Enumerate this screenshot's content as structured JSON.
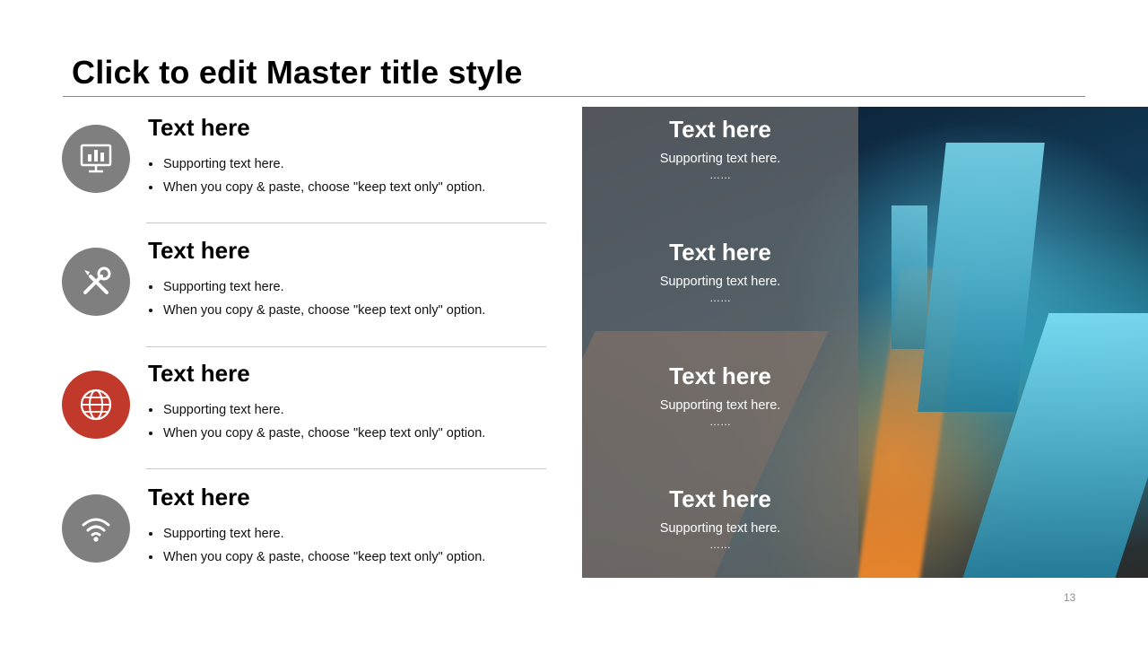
{
  "slide": {
    "title": "Click to edit Master title style",
    "page_number": "13"
  },
  "items": [
    {
      "heading": "Text here",
      "bullets": [
        "Supporting text here.",
        "When you copy & paste, choose \"keep text only\" option."
      ],
      "icon": "presentation-chart-icon",
      "circle_color": "#7f7f7f"
    },
    {
      "heading": "Text here",
      "bullets": [
        "Supporting text here.",
        "When you copy & paste, choose \"keep text only\" option."
      ],
      "icon": "tools-icon",
      "circle_color": "#7f7f7f"
    },
    {
      "heading": "Text here",
      "bullets": [
        "Supporting text here.",
        "When you copy & paste, choose \"keep text only\" option."
      ],
      "icon": "globe-icon",
      "circle_color": "#c0392b"
    },
    {
      "heading": "Text here",
      "bullets": [
        "Supporting text here.",
        "When you copy & paste, choose \"keep text only\" option."
      ],
      "icon": "wifi-icon",
      "circle_color": "#7f7f7f"
    }
  ],
  "overlay": {
    "items": [
      {
        "heading": "Text here",
        "sub": "Supporting text here.",
        "dots": "……"
      },
      {
        "heading": "Text here",
        "sub": "Supporting text here.",
        "dots": "……"
      },
      {
        "heading": "Text here",
        "sub": "Supporting text here.",
        "dots": "……"
      },
      {
        "heading": "Text here",
        "sub": "Supporting text here.",
        "dots": "……"
      }
    ]
  },
  "colors": {
    "accent": "#c0392b",
    "icon_circle": "#7f7f7f",
    "overlay": "#6e6e6e"
  }
}
